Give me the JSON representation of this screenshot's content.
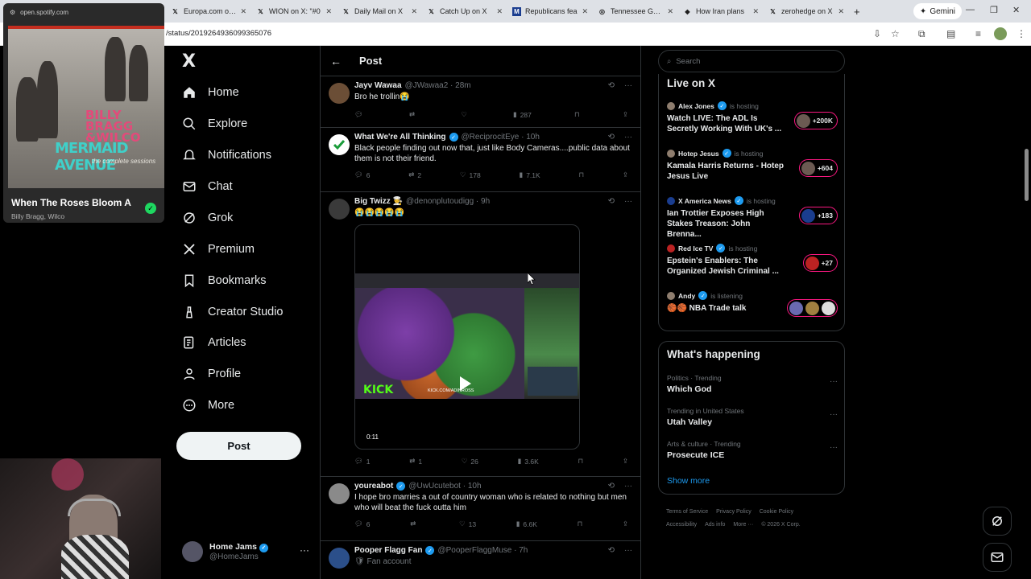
{
  "browser": {
    "tabs": [
      {
        "icon": "x-icon",
        "title": "Europa.com on X"
      },
      {
        "icon": "x-icon",
        "title": "WION on X: \"#0"
      },
      {
        "icon": "x-icon",
        "title": "Daily Mail on X"
      },
      {
        "icon": "x-icon",
        "title": "Catch Up on X"
      },
      {
        "icon": "m-icon",
        "title": "Republicans fea"
      },
      {
        "icon": "globe-icon",
        "title": "Tennessee Gene"
      },
      {
        "icon": "diamond-icon",
        "title": "How Iran plans"
      },
      {
        "icon": "x-icon",
        "title": "zerohedge on X"
      }
    ],
    "gemini_label": "Gemini",
    "url": "/status/2019264936099365076"
  },
  "spotify": {
    "origin": "open.spotify.com",
    "album_line1": "BILLY",
    "album_line2": "BRAGG",
    "album_line3": "&WILCO",
    "album_title": "MERMAID AVENUE",
    "album_sub": "the complete sessions",
    "track": "When The Roses Bloom A",
    "artist": "Billy Bragg, Wilco"
  },
  "nav": {
    "logo": "X",
    "items": [
      "Home",
      "Explore",
      "Notifications",
      "Chat",
      "Grok",
      "Premium",
      "Bookmarks",
      "Creator Studio",
      "Articles",
      "Profile",
      "More"
    ],
    "post_label": "Post",
    "account_name": "Home Jams",
    "account_handle": "@HomeJams",
    "more_dots": "···"
  },
  "feed": {
    "title": "Post",
    "tweets": [
      {
        "name": "Jayv Wawaa",
        "handle": "@JWawaa2 · 28m",
        "text": "Bro he trollin😭",
        "replies": "",
        "retweets": "",
        "likes": "",
        "views": "287"
      },
      {
        "name": "What We're All Thinking",
        "handle": "@ReciprocitEye · 10h",
        "text": "Black people finding out now that, just like Body Cameras....public data about them is not their friend.",
        "replies": "6",
        "retweets": "2",
        "likes": "178",
        "views": "7.1K"
      },
      {
        "name": "Big Twizz 👨‍🍳",
        "handle": "@denonplutoudigg · 9h",
        "text": "😭😭😭😭😭",
        "replies": "1",
        "retweets": "1",
        "likes": "26",
        "views": "3.6K",
        "video_time": "0:11",
        "kick": "KICK",
        "kick_url": "KICK.COM/ADINROSS"
      },
      {
        "name": "youreabot",
        "handle": "@UwUcutebot · 10h",
        "text": "I hope bro marries a out of country woman who is related to nothing but men who will beat the fuck outta him",
        "replies": "6",
        "retweets": "",
        "likes": "13",
        "views": "6.6K"
      },
      {
        "name": "Pooper Flagg Fan",
        "handle": "@PooperFlaggMuse · 7h",
        "text": "Fan account"
      }
    ]
  },
  "sidebar": {
    "search_placeholder": "Search",
    "live_title": "Live on X",
    "live": [
      {
        "host": "Alex Jones",
        "status": "is hosting",
        "title": "Watch LIVE: The ADL Is Secretly Working With UK's ...",
        "count": "+200K"
      },
      {
        "host": "Hotep Jesus",
        "status": "is hosting",
        "title": "Kamala Harris Returns - Hotep Jesus Live",
        "count": "+604"
      },
      {
        "host": "X America News",
        "status": "is hosting",
        "title": "Ian Trottier Exposes High Stakes Treason: John Brenna...",
        "count": "+183"
      },
      {
        "host": "Red Ice TV",
        "status": "is hosting",
        "title": "Epstein's Enablers: The Organized Jewish Criminal ...",
        "count": "+27"
      },
      {
        "host": "Andy",
        "status": "is listening",
        "title": "🏀🏀 NBA Trade talk",
        "count": ""
      }
    ],
    "happening_title": "What's happening",
    "trends": [
      {
        "category": "Politics · Trending",
        "name": "Which God"
      },
      {
        "category": "Trending in United States",
        "name": "Utah Valley"
      },
      {
        "category": "Arts & culture · Trending",
        "name": "Prosecute ICE"
      }
    ],
    "show_more": "Show more",
    "footer": [
      "Terms of Service",
      "Privacy Policy",
      "Cookie Policy",
      "Accessibility",
      "Ads info",
      "More ···",
      "© 2026 X Corp."
    ]
  }
}
